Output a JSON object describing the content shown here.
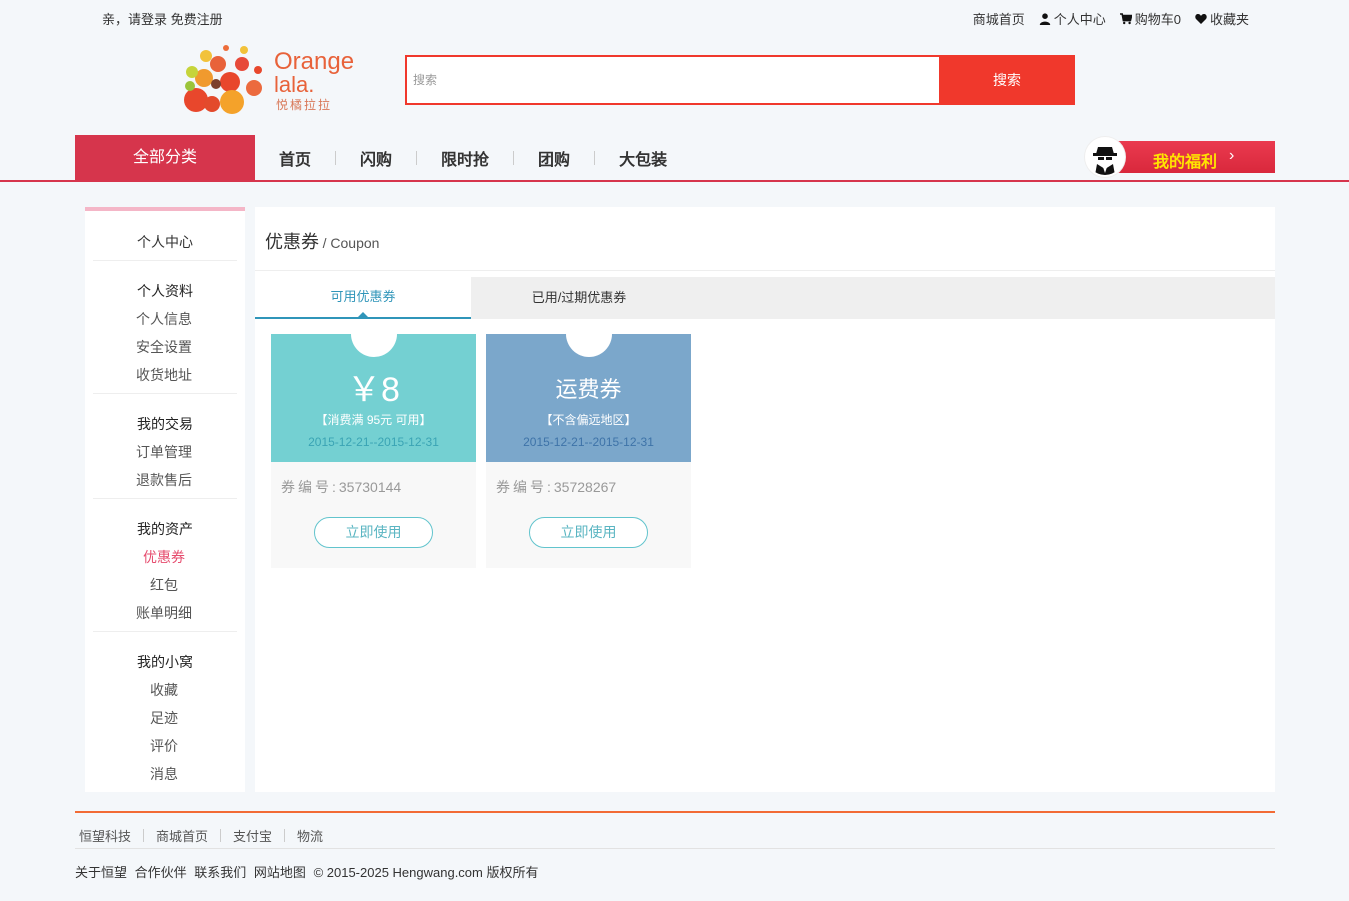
{
  "topbar": {
    "greeting": "亲，请登录",
    "register": "免费注册",
    "mall_home": "商城首页",
    "user_center": "个人中心",
    "cart": "购物车0",
    "favorites": "收藏夹"
  },
  "logo": {
    "line1": "Orange",
    "line2": "lala.",
    "line3": "悦橘拉拉"
  },
  "search": {
    "placeholder": "搜索",
    "button": "搜索"
  },
  "nav": {
    "all_categories": "全部分类",
    "links": [
      "首页",
      "闪购",
      "限时抢",
      "团购",
      "大包装"
    ],
    "welfare": "我的福利",
    "welfare_arrow": "›"
  },
  "sidebar": {
    "title": "个人中心",
    "groups": [
      {
        "title": "个人资料",
        "items": [
          "个人信息",
          "安全设置",
          "收货地址"
        ]
      },
      {
        "title": "我的交易",
        "items": [
          "订单管理",
          "退款售后"
        ]
      },
      {
        "title": "我的资产",
        "items": [
          "优惠券",
          "红包",
          "账单明细"
        ]
      },
      {
        "title": "我的小窝",
        "items": [
          "收藏",
          "足迹",
          "评价",
          "消息"
        ]
      }
    ],
    "active_item": "优惠券"
  },
  "main": {
    "title_zh": "优惠券",
    "title_en": "/ Coupon",
    "tabs": [
      "可用优惠券",
      "已用/过期优惠券"
    ],
    "coupons": [
      {
        "amount": "￥8",
        "condition": "【消费满 95元 可用】",
        "date": "2015-12-21--2015-12-31",
        "code_label": "券编号:",
        "code": "35730144",
        "button": "立即使用",
        "color": "#74d0d2",
        "date_color": "#3aa4b4"
      },
      {
        "amount": "运费券",
        "condition": "【不含偏远地区】",
        "date": "2015-12-21--2015-12-31",
        "code_label": "券编号:",
        "code": "35728267",
        "button": "立即使用",
        "color": "#7ba7cb",
        "date_color": "#3e73a8"
      }
    ]
  },
  "footer": {
    "links": [
      "恒望科技",
      "商城首页",
      "支付宝",
      "物流"
    ],
    "bottom_links": [
      "关于恒望",
      "合作伙伴",
      "联系我们",
      "网站地图"
    ],
    "copyright": "© 2015-2025 Hengwang.com 版权所有"
  },
  "colors": {
    "brand_red": "#d6354c",
    "search_red": "#f0382c",
    "accent_blue": "#2f95b9",
    "active_pink": "#e64c6e",
    "footer_orange": "#f26b35"
  }
}
